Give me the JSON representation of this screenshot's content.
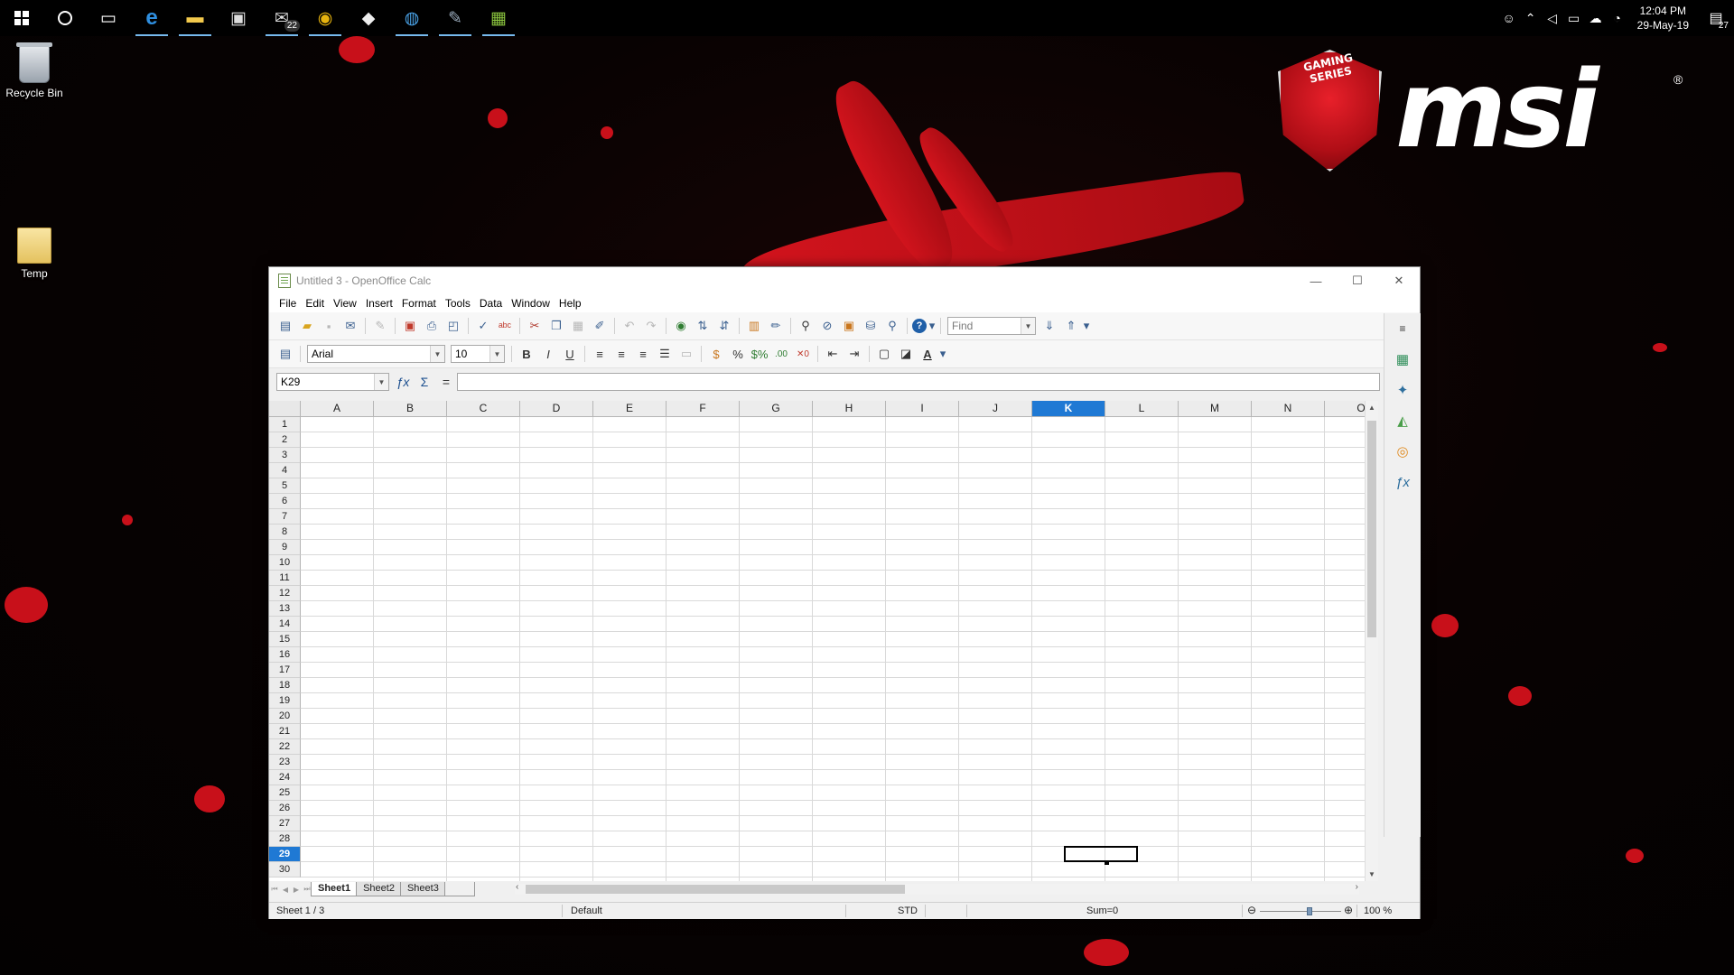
{
  "taskbar": {
    "start_icon": "windows-start-icon",
    "search_icon": "cortana-circle-icon",
    "apps": [
      {
        "name": "task-view-icon",
        "glyph": "▭"
      },
      {
        "name": "edge-icon",
        "glyph": "e"
      },
      {
        "name": "file-explorer-icon",
        "glyph": "▬"
      },
      {
        "name": "store-icon",
        "glyph": "▣"
      },
      {
        "name": "mail-icon",
        "glyph": "✉",
        "badge": "22"
      },
      {
        "name": "chrome-icon",
        "glyph": "◉"
      },
      {
        "name": "fox-icon",
        "glyph": "◆"
      },
      {
        "name": "chat-icon",
        "glyph": "◍"
      },
      {
        "name": "tool-icon",
        "glyph": "✎"
      },
      {
        "name": "calc-app-icon",
        "glyph": "▦"
      }
    ],
    "clock_time": "12:04 PM",
    "clock_date": "29-May-19",
    "notification_count": "27"
  },
  "desktop": {
    "icons": [
      {
        "label": "Recycle Bin"
      },
      {
        "label": "Temp"
      }
    ],
    "brand": {
      "shield_text": "GAMING SERIES",
      "logo_text": "msi",
      "reg": "®"
    }
  },
  "window": {
    "title": "Untitled 3 - OpenOffice Calc",
    "menu": [
      "File",
      "Edit",
      "View",
      "Insert",
      "Format",
      "Tools",
      "Data",
      "Window",
      "Help"
    ],
    "font_name": "Arial",
    "font_size": "10",
    "find_placeholder": "Find",
    "name_box": "K29",
    "formula_value": "",
    "columns": [
      "A",
      "B",
      "C",
      "D",
      "E",
      "F",
      "G",
      "H",
      "I",
      "J",
      "K",
      "L",
      "M",
      "N",
      "O"
    ],
    "selected_column": "K",
    "rows": [
      "1",
      "2",
      "3",
      "4",
      "5",
      "6",
      "7",
      "8",
      "9",
      "10",
      "11",
      "12",
      "13",
      "14",
      "15",
      "16",
      "17",
      "18",
      "19",
      "20",
      "21",
      "22",
      "23",
      "24",
      "25",
      "26",
      "27",
      "28",
      "29",
      "30"
    ],
    "selected_row": "29",
    "sheets": [
      "Sheet1",
      "Sheet2",
      "Sheet3"
    ],
    "active_sheet": "Sheet1",
    "status": {
      "sheet_info": "Sheet 1 / 3",
      "page_style": "Default",
      "mode": "STD",
      "sum": "Sum=0",
      "zoom": "100 %"
    }
  },
  "colors": {
    "selection": "#1f79d4",
    "wallpaper_red": "#c8101a"
  }
}
